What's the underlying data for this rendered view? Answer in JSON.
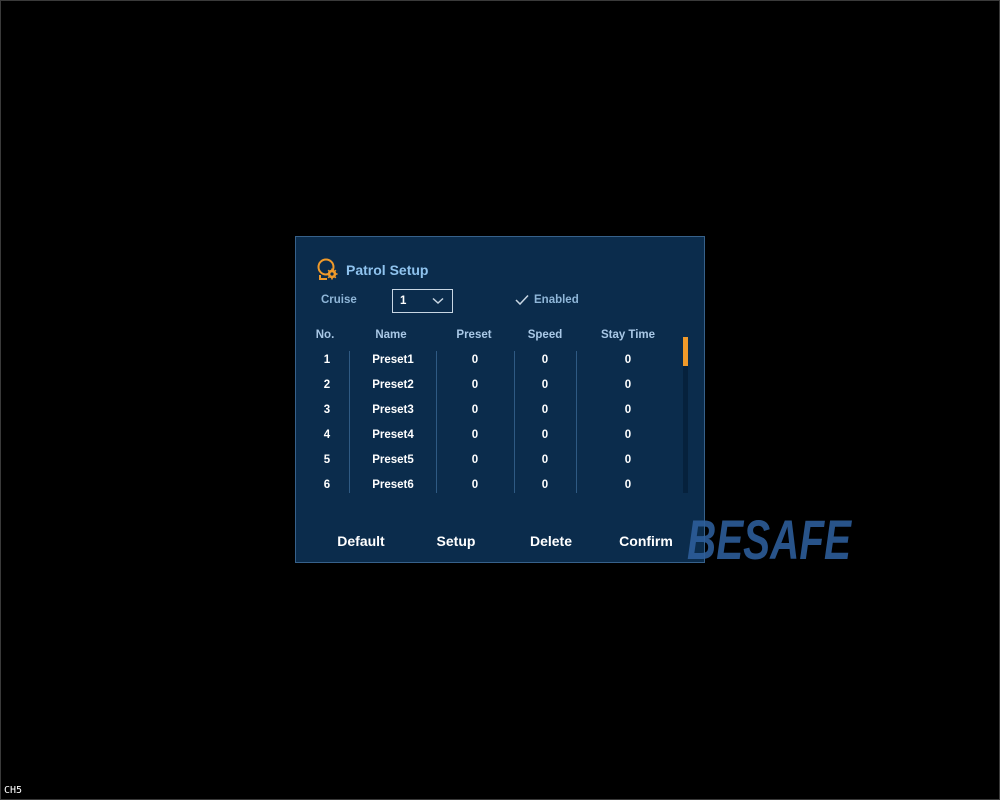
{
  "dialog": {
    "title": "Patrol Setup",
    "title_icon": "ptz-camera-gear-icon",
    "cruise_label": "Cruise",
    "cruise_value": "1",
    "enabled_label": "Enabled",
    "enabled_checked": true
  },
  "table": {
    "headers": {
      "no": "No.",
      "name": "Name",
      "preset": "Preset",
      "speed": "Speed",
      "stay_time": "Stay Time"
    },
    "rows": [
      {
        "no": "1",
        "name": "Preset1",
        "preset": "0",
        "speed": "0",
        "stay_time": "0"
      },
      {
        "no": "2",
        "name": "Preset2",
        "preset": "0",
        "speed": "0",
        "stay_time": "0"
      },
      {
        "no": "3",
        "name": "Preset3",
        "preset": "0",
        "speed": "0",
        "stay_time": "0"
      },
      {
        "no": "4",
        "name": "Preset4",
        "preset": "0",
        "speed": "0",
        "stay_time": "0"
      },
      {
        "no": "5",
        "name": "Preset5",
        "preset": "0",
        "speed": "0",
        "stay_time": "0"
      },
      {
        "no": "6",
        "name": "Preset6",
        "preset": "0",
        "speed": "0",
        "stay_time": "0"
      }
    ]
  },
  "buttons": {
    "default": "Default",
    "setup": "Setup",
    "delete": "Delete",
    "confirm": "Confirm"
  },
  "watermark": "BESAFE",
  "channel_label": "CH5",
  "colors": {
    "background": "#000000",
    "dialog_bg": "#0b2c4c",
    "accent": "#f09a2a",
    "title": "#8fc3ee",
    "watermark": "#2e5f9c"
  }
}
